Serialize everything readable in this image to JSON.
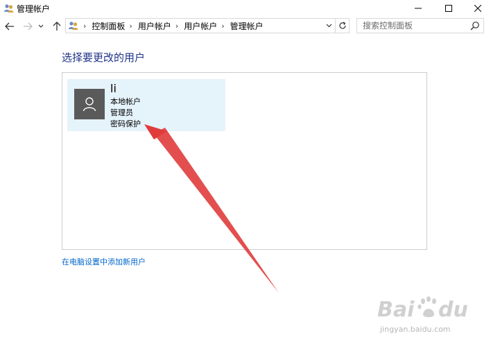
{
  "window": {
    "title": "管理帐户",
    "icon": "users-control-panel-icon"
  },
  "navigation": {
    "breadcrumbs": [
      "控制面板",
      "用户帐户",
      "用户帐户",
      "管理帐户"
    ],
    "search_placeholder": "搜索控制面板"
  },
  "main": {
    "heading": "选择要更改的用户",
    "users": [
      {
        "name": "li",
        "account_type": "本地帐户",
        "role": "管理员",
        "security": "密码保护"
      }
    ],
    "add_user_link": "在电脑设置中添加新用户"
  },
  "watermark": {
    "url": "jingyan.baidu.com"
  },
  "colors": {
    "heading": "#1e3287",
    "link": "#0066cc",
    "tile_background": "#e5f3fb",
    "avatar_background": "#5a5a5a",
    "annotation_arrow": "#e03c3c"
  }
}
